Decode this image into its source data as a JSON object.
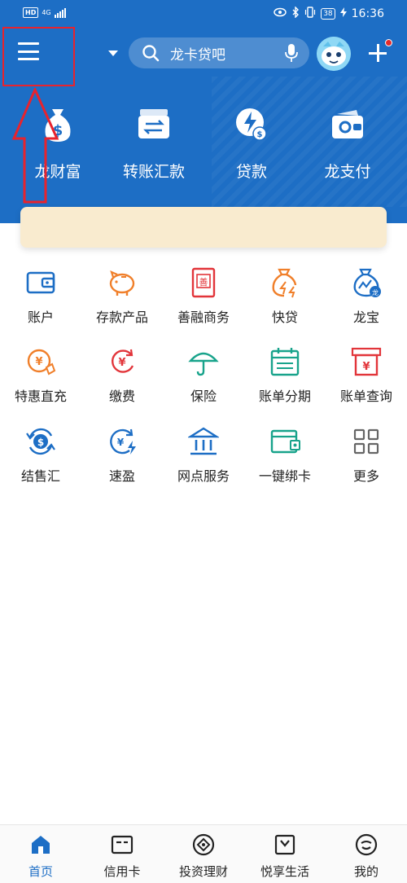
{
  "status_bar": {
    "hd": "HD",
    "network": "4G",
    "battery": "38",
    "time": "16:36"
  },
  "header": {
    "search_placeholder": "龙卡贷吧",
    "menu_icon": "hamburger-menu-icon",
    "quick_actions": [
      {
        "label": "龙财富",
        "icon": "money-bag-icon"
      },
      {
        "label": "转账汇款",
        "icon": "transfer-icon"
      },
      {
        "label": "贷款",
        "icon": "loan-icon"
      },
      {
        "label": "龙支付",
        "icon": "wallet-pay-icon"
      }
    ]
  },
  "services": [
    {
      "label": "账户",
      "icon": "wallet-icon",
      "color": "#1d6ec5"
    },
    {
      "label": "存款产品",
      "icon": "piggy-bank-icon",
      "color": "#f07f2a"
    },
    {
      "label": "善融商务",
      "icon": "shanrong-icon",
      "color": "#e2353a"
    },
    {
      "label": "快贷",
      "icon": "quick-loan-icon",
      "color": "#f07f2a"
    },
    {
      "label": "龙宝",
      "icon": "longbao-icon",
      "color": "#1d6ec5"
    },
    {
      "label": "特惠直充",
      "icon": "recharge-icon",
      "color": "#f07f2a"
    },
    {
      "label": "缴费",
      "icon": "payment-icon",
      "color": "#e2353a"
    },
    {
      "label": "保险",
      "icon": "umbrella-icon",
      "color": "#18a38b"
    },
    {
      "label": "账单分期",
      "icon": "calendar-icon",
      "color": "#18a38b"
    },
    {
      "label": "账单查询",
      "icon": "bill-query-icon",
      "color": "#e2353a"
    },
    {
      "label": "结售汇",
      "icon": "exchange-icon",
      "color": "#1d6ec5"
    },
    {
      "label": "速盈",
      "icon": "suying-icon",
      "color": "#1d6ec5"
    },
    {
      "label": "网点服务",
      "icon": "bank-branch-icon",
      "color": "#1d6ec5"
    },
    {
      "label": "一键绑卡",
      "icon": "bind-card-icon",
      "color": "#18a38b"
    },
    {
      "label": "更多",
      "icon": "more-grid-icon",
      "color": "#666666"
    }
  ],
  "bottom_nav": [
    {
      "label": "首页",
      "icon": "home-icon",
      "active": true
    },
    {
      "label": "信用卡",
      "icon": "credit-card-icon",
      "active": false
    },
    {
      "label": "投资理财",
      "icon": "invest-icon",
      "active": false
    },
    {
      "label": "悦享生活",
      "icon": "life-bag-icon",
      "active": false
    },
    {
      "label": "我的",
      "icon": "profile-icon",
      "active": false
    }
  ],
  "colors": {
    "brand_blue": "#1d6ec5",
    "annotation_red": "#e8232d"
  }
}
